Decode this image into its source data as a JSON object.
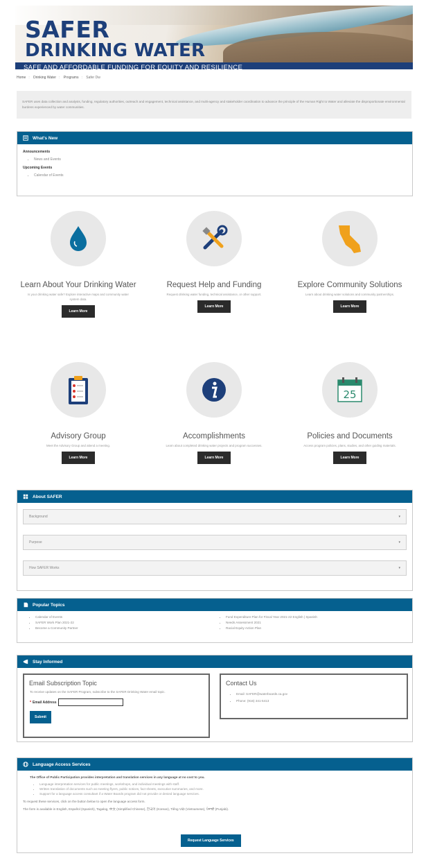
{
  "header": {
    "title_line1": "SAFER",
    "title_line2": "DRINKING WATER",
    "tagline": "SAFE AND AFFORDABLE FUNDING FOR EQUITY AND RESILIENCE"
  },
  "breadcrumb": [
    "Home",
    "Drinking Water",
    "Programs",
    "Safer Dw"
  ],
  "intro": "SAFER uses data collection and analysis, funding, regulatory authorities, outreach and engagement, technical assistance, and multi-agency and stakeholder coordination to advance the principle of the Human Right to Water and alleviate the disproportionate environmental burdens experienced by water communities.",
  "whats_new": {
    "heading": "What's New",
    "announcements_label": "Announcements",
    "announcements": [
      "News and Events"
    ],
    "upcoming_label": "Upcoming Events",
    "upcoming": [
      "Calendar of Events"
    ]
  },
  "tiles": [
    {
      "icon": "water-drop-icon",
      "title": "Learn About Your Drinking Water",
      "desc": "Is your drinking water safe? Explore interactive maps and community water system data.",
      "button": "Learn More"
    },
    {
      "icon": "tools-icon",
      "title": "Request Help and Funding",
      "desc": "Request drinking water funding, technical assistance, or other support.",
      "button": "Learn More"
    },
    {
      "icon": "california-icon",
      "title": "Explore Community Solutions",
      "desc": "Learn about drinking water solutions and community partnerships.",
      "button": "Learn More"
    },
    {
      "icon": "clipboard-icon",
      "title": "Advisory Group",
      "desc": "Meet the Advisory Group and attend a meeting.",
      "button": "Learn More"
    },
    {
      "icon": "info-icon",
      "title": "Accomplishments",
      "desc": "Learn about completed drinking water projects and program successes.",
      "button": "Learn More"
    },
    {
      "icon": "calendar-icon",
      "title": "Policies and Documents",
      "desc": "Access program policies, plans, studies, and other guiding materials.",
      "button": "Learn More",
      "calendar_day": "25"
    }
  ],
  "about": {
    "heading": "About SAFER",
    "items": [
      "Background",
      "Purpose",
      "How SAFER Works"
    ]
  },
  "popular": {
    "heading": "Popular Topics",
    "left": [
      "Calendar of Events",
      "SAFER Work Plan 2021-22",
      "Become a Community Partner"
    ],
    "right": [
      "Fund Expenditure Plan for Fiscal Year 2021-22 English | Spanish",
      "Needs Assessment 2021",
      "Racial Equity Action Plan"
    ]
  },
  "stay": {
    "heading": "Stay Informed",
    "email_title": "Email Subscription Topic",
    "email_desc": "To receive updates on the SAFER Program, subscribe to the SAFER Drinking Water email topic.",
    "email_required": "*",
    "email_label": "Email Address",
    "submit": "Submit",
    "contact_title": "Contact Us",
    "contact_email": "Email: SAFER@waterboards.ca.gov",
    "contact_phone": "Phone: (916) 341-5413"
  },
  "language": {
    "heading": "Language Access Services",
    "lead": "The Office of Public Participation provides interpretation and translation services in any language at no cost to you.",
    "items": [
      "Language interpretation services for public meetings, workshops, and individual meetings with staff.",
      "Written translation of documents such as meeting flyers, public notices, fact sheets, executive summaries, and more.",
      "Support for a language access consultant if a Water Boards program did not provide or denied language services."
    ],
    "request_text": "To request these services, click on the button below to open the language access form.",
    "languages_text": "The form is available in English, Español (Spanish), Tagalog, 中文 (Simplified Chinese), 한국어 (Korean), Tiếng Việt (Vietnamese), ਪੰਜਾਬੀ (Punjabi).",
    "button": "Request Language Services"
  },
  "colors": {
    "brand_blue": "#05608f",
    "banner_navy": "#1d3f7a",
    "dark_button": "#2b2b2b"
  }
}
